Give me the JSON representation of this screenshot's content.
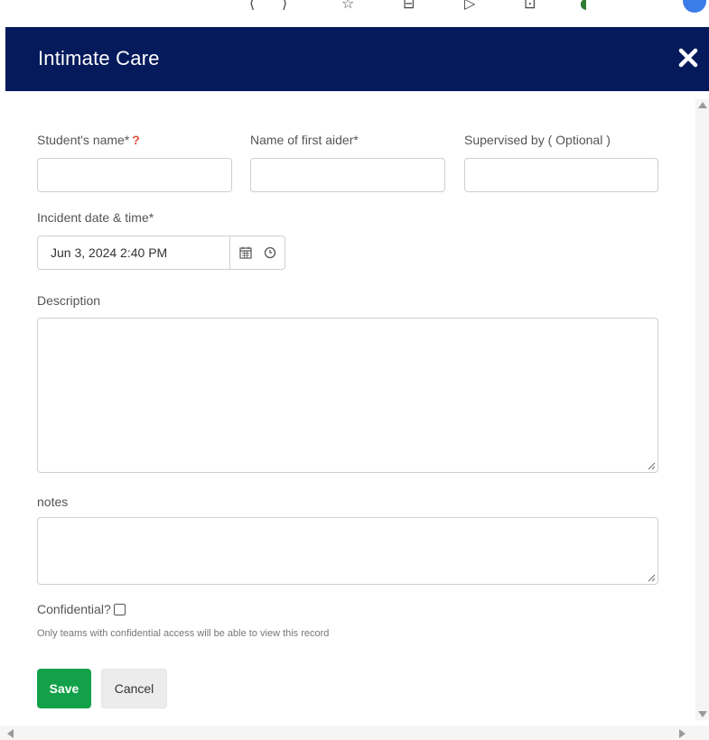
{
  "modal": {
    "title": "Intimate Care",
    "close_icon": "close-icon"
  },
  "form": {
    "student_name": {
      "label": "Student's name*",
      "help": "?",
      "value": ""
    },
    "first_aider": {
      "label": "Name of first aider*",
      "value": ""
    },
    "supervised_by": {
      "label": "Supervised by ( Optional )",
      "value": ""
    },
    "incident_datetime": {
      "label": "Incident date & time*",
      "value": "Jun 3, 2024 2:40 PM",
      "icons": [
        "calendar-icon",
        "clock-icon"
      ]
    },
    "description": {
      "label": "Description",
      "value": ""
    },
    "notes": {
      "label": "notes",
      "value": ""
    },
    "confidential": {
      "label": "Confidential?",
      "checked": false,
      "hint": "Only teams with confidential access will be able to view this record"
    }
  },
  "actions": {
    "save_label": "Save",
    "cancel_label": "Cancel"
  },
  "colors": {
    "header_bg": "#041a5b",
    "save_bg": "#12a14a",
    "help_mark": "#e74c3c"
  }
}
